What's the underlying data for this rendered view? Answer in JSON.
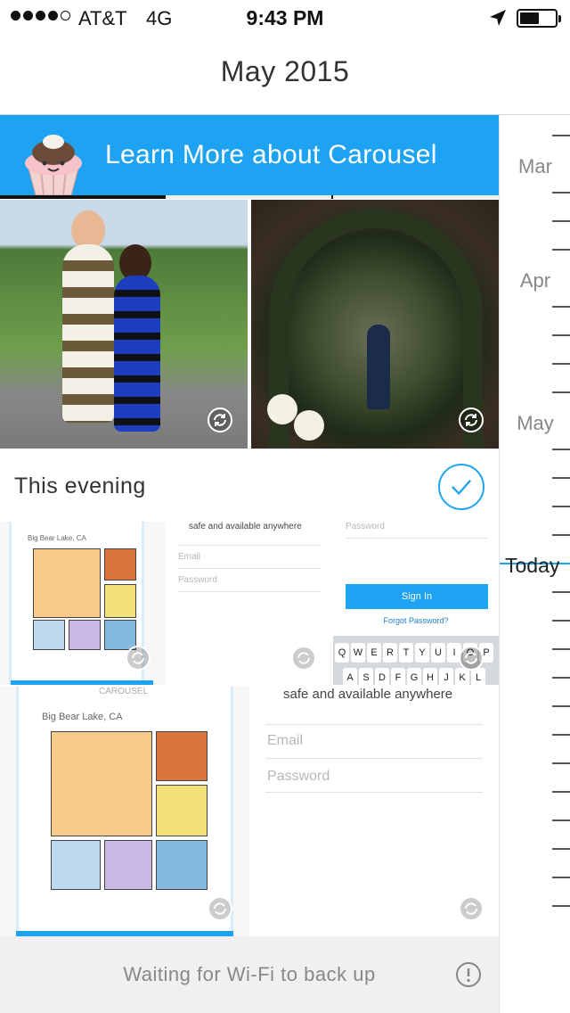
{
  "status_bar": {
    "carrier": "AT&T",
    "network": "4G",
    "time": "9:43 PM",
    "signal_bars": 4,
    "battery_level": 0.55
  },
  "nav": {
    "title": "May 2015"
  },
  "banner": {
    "text": "Learn More about Carousel",
    "icon": "cupcake-icon",
    "color": "#1ea3f2"
  },
  "section": {
    "label": "This evening",
    "selected": true
  },
  "screenshots": {
    "location": "Big Bear Lake, CA",
    "heading": "safe and available anywhere",
    "email_placeholder": "Email",
    "password_placeholder": "Password",
    "sign_in_label": "Sign In",
    "forgot_password": "Forgot Password?",
    "keyboard_row1": [
      "Q",
      "W",
      "E",
      "R",
      "T",
      "Y",
      "U",
      "I",
      "O",
      "P"
    ],
    "keyboard_row2": [
      "A",
      "S",
      "D",
      "F",
      "G",
      "H",
      "J",
      "K",
      "L"
    ],
    "app_header": "CAROUSEL"
  },
  "bottom_bar": {
    "message": "Waiting for Wi-Fi to back up",
    "icon": "alert-icon"
  },
  "timeline": {
    "months": [
      "Mar",
      "Apr",
      "May"
    ],
    "today_label": "Today"
  }
}
